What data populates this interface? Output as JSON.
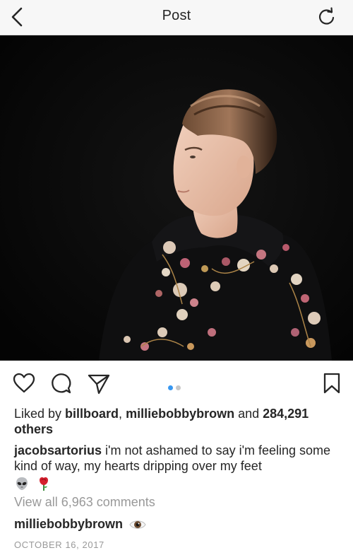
{
  "header": {
    "title": "Post",
    "back_icon": "chevron-left-icon",
    "refresh_icon": "refresh-icon"
  },
  "post": {
    "image_icon": "photo",
    "actions": {
      "like_icon": "heart-icon",
      "comment_icon": "comment-icon",
      "share_icon": "send-icon",
      "save_icon": "bookmark-icon"
    },
    "carousel": {
      "count": 2,
      "active_index": 0
    },
    "likes": {
      "prefix": "Liked by ",
      "user1": "billboard",
      "separator": ", ",
      "user2": "milliebobbybrown",
      "middle": " and ",
      "count": "284,291 others"
    },
    "caption": {
      "username": "jacobsartorius",
      "text": " i'm not ashamed to say i'm feeling some kind of way, my hearts dripping over my feet",
      "emojis": [
        "alien-emoji",
        "rose-emoji"
      ]
    },
    "view_comments": "View all 6,963 comments",
    "top_comment": {
      "username": "milliebobbybrown",
      "emoji": "eye-emoji"
    },
    "date": "OCTOBER 16, 2017"
  },
  "colors": {
    "accent": "#3897f0",
    "muted": "#999999",
    "text": "#262626",
    "header_bg": "#f7f7f7"
  }
}
